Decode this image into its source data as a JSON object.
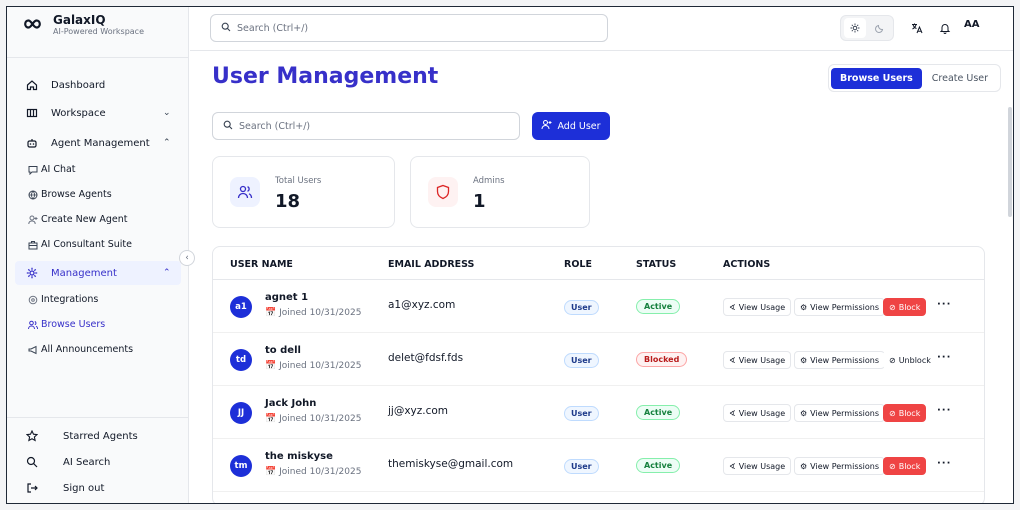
{
  "brand": {
    "name": "GalaxIQ",
    "tagline": "AI-Powered Workspace"
  },
  "sidebar": {
    "nav": [
      {
        "label": "Dashboard",
        "icon": "home-icon"
      },
      {
        "label": "Workspace",
        "icon": "workspace-icon"
      },
      {
        "label": "Agent Management",
        "icon": "robot-icon"
      },
      {
        "label": "Management",
        "icon": "gear-icon"
      }
    ],
    "agent_sub": [
      {
        "label": "AI Chat",
        "icon": "chat-icon"
      },
      {
        "label": "Browse Agents",
        "icon": "globe-icon"
      },
      {
        "label": "Create New Agent",
        "icon": "user-plus-icon"
      },
      {
        "label": "AI Consultant Suite",
        "icon": "briefcase-icon"
      }
    ],
    "mgmt_sub": [
      {
        "label": "Integrations",
        "icon": "integration-icon"
      },
      {
        "label": "Browse Users",
        "icon": "users-icon"
      },
      {
        "label": "All Announcements",
        "icon": "megaphone-icon"
      }
    ],
    "bottom": [
      {
        "label": "Starred Agents",
        "icon": "star-icon"
      },
      {
        "label": "AI Search",
        "icon": "search-icon"
      },
      {
        "label": "Sign out",
        "icon": "sign-out-icon"
      }
    ]
  },
  "topbar": {
    "search_placeholder": "Search (Ctrl+/)",
    "avatar": "AA"
  },
  "page": {
    "title": "User Management",
    "tab_browse": "Browse Users",
    "tab_create": "Create User"
  },
  "main": {
    "search_placeholder": "Search (Ctrl+/)",
    "add_user": "Add User"
  },
  "stats": [
    {
      "label": "Total Users",
      "value": "18"
    },
    {
      "label": "Admins",
      "value": "1"
    }
  ],
  "table": {
    "headers": [
      "USER NAME",
      "EMAIL ADDRESS",
      "ROLE",
      "STATUS",
      "ACTIONS"
    ],
    "rows": [
      {
        "initials": "a1",
        "name": "agnet 1",
        "joined": "Joined 10/31/2025",
        "email": "a1@xyz.com",
        "role": "User",
        "status": "Active",
        "toggle": "Block"
      },
      {
        "initials": "td",
        "name": "to dell",
        "joined": "Joined 10/31/2025",
        "email": "delet@fdsf.fds",
        "role": "User",
        "status": "Blocked",
        "toggle": "Unblock"
      },
      {
        "initials": "JJ",
        "name": "Jack John",
        "joined": "Joined 10/31/2025",
        "email": "jj@xyz.com",
        "role": "User",
        "status": "Active",
        "toggle": "Block"
      },
      {
        "initials": "tm",
        "name": "the miskyse",
        "joined": "Joined 10/31/2025",
        "email": "themiskyse@gmail.com",
        "role": "User",
        "status": "Active",
        "toggle": "Block"
      }
    ],
    "view_usage": "View Usage",
    "view_permissions": "View Permissions",
    "more": "···"
  },
  "colors": {
    "accent": "#1d2fd8",
    "title": "#3730c9",
    "danger": "#ef4444",
    "success": "#15803d"
  }
}
